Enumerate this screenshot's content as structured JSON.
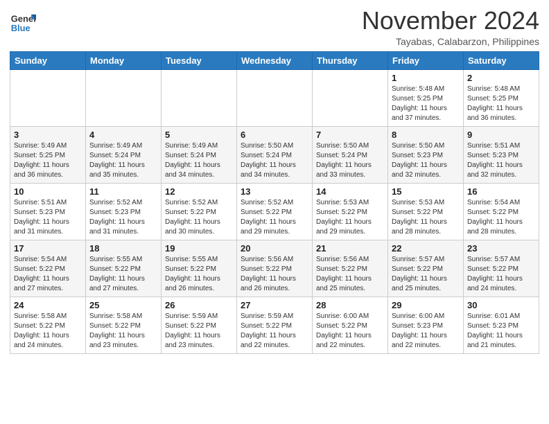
{
  "header": {
    "logo_line1": "General",
    "logo_line2": "Blue",
    "month": "November 2024",
    "location": "Tayabas, Calabarzon, Philippines"
  },
  "weekdays": [
    "Sunday",
    "Monday",
    "Tuesday",
    "Wednesday",
    "Thursday",
    "Friday",
    "Saturday"
  ],
  "weeks": [
    [
      {
        "day": "",
        "info": ""
      },
      {
        "day": "",
        "info": ""
      },
      {
        "day": "",
        "info": ""
      },
      {
        "day": "",
        "info": ""
      },
      {
        "day": "",
        "info": ""
      },
      {
        "day": "1",
        "info": "Sunrise: 5:48 AM\nSunset: 5:25 PM\nDaylight: 11 hours\nand 37 minutes."
      },
      {
        "day": "2",
        "info": "Sunrise: 5:48 AM\nSunset: 5:25 PM\nDaylight: 11 hours\nand 36 minutes."
      }
    ],
    [
      {
        "day": "3",
        "info": "Sunrise: 5:49 AM\nSunset: 5:25 PM\nDaylight: 11 hours\nand 36 minutes."
      },
      {
        "day": "4",
        "info": "Sunrise: 5:49 AM\nSunset: 5:24 PM\nDaylight: 11 hours\nand 35 minutes."
      },
      {
        "day": "5",
        "info": "Sunrise: 5:49 AM\nSunset: 5:24 PM\nDaylight: 11 hours\nand 34 minutes."
      },
      {
        "day": "6",
        "info": "Sunrise: 5:50 AM\nSunset: 5:24 PM\nDaylight: 11 hours\nand 34 minutes."
      },
      {
        "day": "7",
        "info": "Sunrise: 5:50 AM\nSunset: 5:24 PM\nDaylight: 11 hours\nand 33 minutes."
      },
      {
        "day": "8",
        "info": "Sunrise: 5:50 AM\nSunset: 5:23 PM\nDaylight: 11 hours\nand 32 minutes."
      },
      {
        "day": "9",
        "info": "Sunrise: 5:51 AM\nSunset: 5:23 PM\nDaylight: 11 hours\nand 32 minutes."
      }
    ],
    [
      {
        "day": "10",
        "info": "Sunrise: 5:51 AM\nSunset: 5:23 PM\nDaylight: 11 hours\nand 31 minutes."
      },
      {
        "day": "11",
        "info": "Sunrise: 5:52 AM\nSunset: 5:23 PM\nDaylight: 11 hours\nand 31 minutes."
      },
      {
        "day": "12",
        "info": "Sunrise: 5:52 AM\nSunset: 5:22 PM\nDaylight: 11 hours\nand 30 minutes."
      },
      {
        "day": "13",
        "info": "Sunrise: 5:52 AM\nSunset: 5:22 PM\nDaylight: 11 hours\nand 29 minutes."
      },
      {
        "day": "14",
        "info": "Sunrise: 5:53 AM\nSunset: 5:22 PM\nDaylight: 11 hours\nand 29 minutes."
      },
      {
        "day": "15",
        "info": "Sunrise: 5:53 AM\nSunset: 5:22 PM\nDaylight: 11 hours\nand 28 minutes."
      },
      {
        "day": "16",
        "info": "Sunrise: 5:54 AM\nSunset: 5:22 PM\nDaylight: 11 hours\nand 28 minutes."
      }
    ],
    [
      {
        "day": "17",
        "info": "Sunrise: 5:54 AM\nSunset: 5:22 PM\nDaylight: 11 hours\nand 27 minutes."
      },
      {
        "day": "18",
        "info": "Sunrise: 5:55 AM\nSunset: 5:22 PM\nDaylight: 11 hours\nand 27 minutes."
      },
      {
        "day": "19",
        "info": "Sunrise: 5:55 AM\nSunset: 5:22 PM\nDaylight: 11 hours\nand 26 minutes."
      },
      {
        "day": "20",
        "info": "Sunrise: 5:56 AM\nSunset: 5:22 PM\nDaylight: 11 hours\nand 26 minutes."
      },
      {
        "day": "21",
        "info": "Sunrise: 5:56 AM\nSunset: 5:22 PM\nDaylight: 11 hours\nand 25 minutes."
      },
      {
        "day": "22",
        "info": "Sunrise: 5:57 AM\nSunset: 5:22 PM\nDaylight: 11 hours\nand 25 minutes."
      },
      {
        "day": "23",
        "info": "Sunrise: 5:57 AM\nSunset: 5:22 PM\nDaylight: 11 hours\nand 24 minutes."
      }
    ],
    [
      {
        "day": "24",
        "info": "Sunrise: 5:58 AM\nSunset: 5:22 PM\nDaylight: 11 hours\nand 24 minutes."
      },
      {
        "day": "25",
        "info": "Sunrise: 5:58 AM\nSunset: 5:22 PM\nDaylight: 11 hours\nand 23 minutes."
      },
      {
        "day": "26",
        "info": "Sunrise: 5:59 AM\nSunset: 5:22 PM\nDaylight: 11 hours\nand 23 minutes."
      },
      {
        "day": "27",
        "info": "Sunrise: 5:59 AM\nSunset: 5:22 PM\nDaylight: 11 hours\nand 22 minutes."
      },
      {
        "day": "28",
        "info": "Sunrise: 6:00 AM\nSunset: 5:22 PM\nDaylight: 11 hours\nand 22 minutes."
      },
      {
        "day": "29",
        "info": "Sunrise: 6:00 AM\nSunset: 5:23 PM\nDaylight: 11 hours\nand 22 minutes."
      },
      {
        "day": "30",
        "info": "Sunrise: 6:01 AM\nSunset: 5:23 PM\nDaylight: 11 hours\nand 21 minutes."
      }
    ]
  ]
}
